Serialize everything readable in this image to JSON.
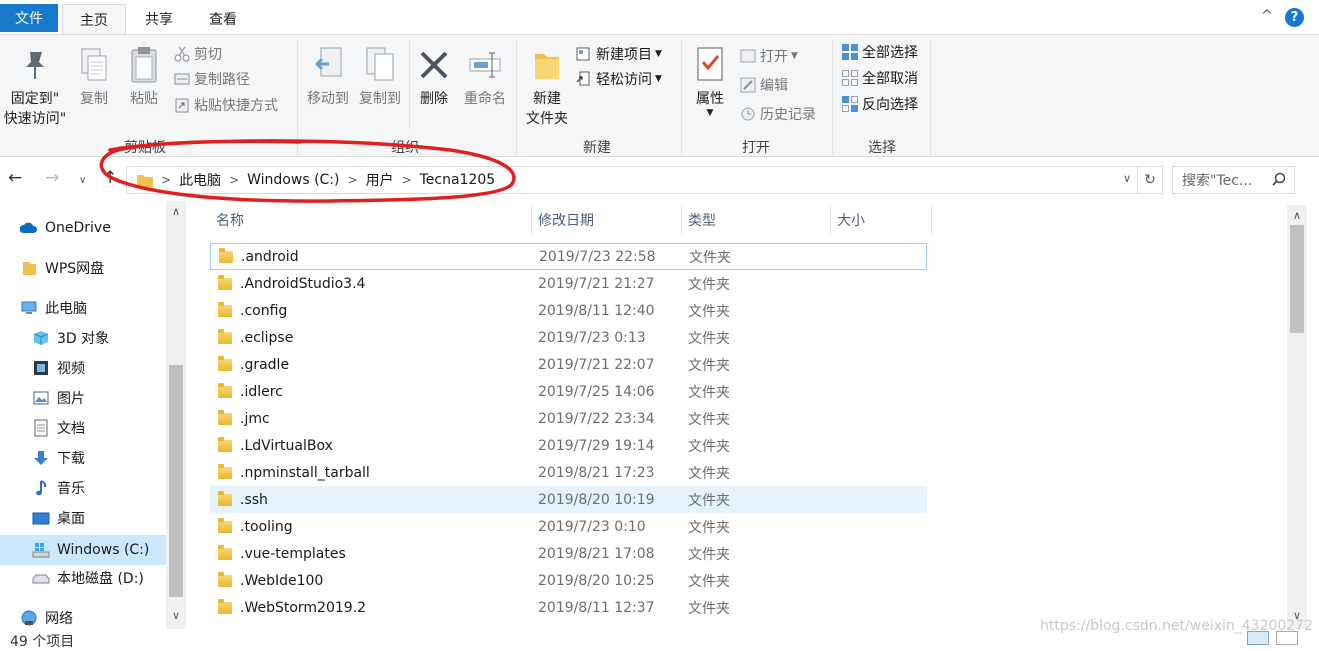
{
  "tabs": {
    "file": "文件",
    "home": "主页",
    "share": "共享",
    "view": "查看"
  },
  "window": {
    "collapse_glyph": "^",
    "help_glyph": "?"
  },
  "ribbon": {
    "clipboard": {
      "pin_label_1": "固定到\"",
      "pin_label_2": "快速访问\"",
      "copy": "复制",
      "paste": "粘贴",
      "cut": "剪切",
      "copy_path": "复制路径",
      "paste_shortcut": "粘贴快捷方式",
      "group": "剪贴板"
    },
    "organize": {
      "move_to": "移动到",
      "copy_to": "复制到",
      "delete": "删除",
      "rename": "重命名",
      "group": "组织"
    },
    "new": {
      "new_folder_1": "新建",
      "new_folder_2": "文件夹",
      "new_item": "新建项目",
      "easy_access": "轻松访问",
      "group": "新建"
    },
    "open": {
      "properties": "属性",
      "open": "打开",
      "edit": "编辑",
      "history": "历史记录",
      "group": "打开"
    },
    "select": {
      "select_all": "全部选择",
      "select_none": "全部取消",
      "invert": "反向选择",
      "group": "选择"
    }
  },
  "address": {
    "crumbs": [
      "此电脑",
      "Windows (C:)",
      "用户",
      "Tecna1205"
    ],
    "search_placeholder": "搜索\"Tec..."
  },
  "sidebar": {
    "items": [
      "OneDrive",
      "WPS网盘",
      "此电脑",
      "3D 对象",
      "视频",
      "图片",
      "文档",
      "下载",
      "音乐",
      "桌面",
      "Windows (C:)",
      "本地磁盘 (D:)",
      "网络"
    ]
  },
  "columns": {
    "name": "名称",
    "date": "修改日期",
    "type": "类型",
    "size": "大小"
  },
  "files": [
    {
      "name": ".android",
      "date": "2019/7/23 22:58",
      "type": "文件夹"
    },
    {
      "name": ".AndroidStudio3.4",
      "date": "2019/7/21 21:27",
      "type": "文件夹"
    },
    {
      "name": ".config",
      "date": "2019/8/11 12:40",
      "type": "文件夹"
    },
    {
      "name": ".eclipse",
      "date": "2019/7/23 0:13",
      "type": "文件夹"
    },
    {
      "name": ".gradle",
      "date": "2019/7/21 22:07",
      "type": "文件夹"
    },
    {
      "name": ".idlerc",
      "date": "2019/7/25 14:06",
      "type": "文件夹"
    },
    {
      "name": ".jmc",
      "date": "2019/7/22 23:34",
      "type": "文件夹"
    },
    {
      "name": ".LdVirtualBox",
      "date": "2019/7/29 19:14",
      "type": "文件夹"
    },
    {
      "name": ".npminstall_tarball",
      "date": "2019/8/21 17:23",
      "type": "文件夹"
    },
    {
      "name": ".ssh",
      "date": "2019/8/20 10:19",
      "type": "文件夹"
    },
    {
      "name": ".tooling",
      "date": "2019/7/23 0:10",
      "type": "文件夹"
    },
    {
      "name": ".vue-templates",
      "date": "2019/8/21 17:08",
      "type": "文件夹"
    },
    {
      "name": ".WebIde100",
      "date": "2019/8/20 10:25",
      "type": "文件夹"
    },
    {
      "name": ".WebStorm2019.2",
      "date": "2019/8/11 12:37",
      "type": "文件夹"
    }
  ],
  "status": {
    "count": "49 个项目"
  },
  "watermark": "https://blog.csdn.net/weixin_43200272",
  "colors": {
    "accent": "#1979ca",
    "selection": "#cce8ff",
    "annotation": "#e02020"
  }
}
